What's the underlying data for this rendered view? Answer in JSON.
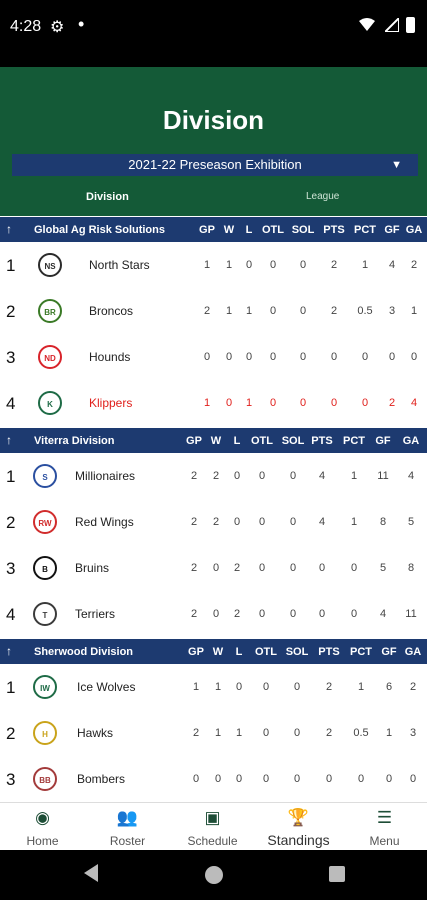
{
  "status": {
    "time": "4:28"
  },
  "header": {
    "title": "Division",
    "season": "2021-22 Preseason Exhibition",
    "tabs": {
      "division": "Division",
      "league": "League"
    }
  },
  "columns": [
    "GP",
    "W",
    "L",
    "OTL",
    "SOL",
    "PTS",
    "PCT",
    "GF",
    "GA"
  ],
  "divisions": [
    {
      "name": "Global Ag Risk Solutions",
      "teams": [
        {
          "rank": "1",
          "name": "North Stars",
          "logo": "NS",
          "logo_color": "#2b2b2b",
          "stats": [
            "1",
            "1",
            "0",
            "0",
            "0",
            "2",
            "1",
            "4",
            "2"
          ]
        },
        {
          "rank": "2",
          "name": "Broncos",
          "logo": "BR",
          "logo_color": "#3a7a26",
          "stats": [
            "2",
            "1",
            "1",
            "0",
            "0",
            "2",
            "0.5",
            "3",
            "1"
          ]
        },
        {
          "rank": "3",
          "name": "Hounds",
          "logo": "ND",
          "logo_color": "#d8232a",
          "stats": [
            "0",
            "0",
            "0",
            "0",
            "0",
            "0",
            "0",
            "0",
            "0"
          ]
        },
        {
          "rank": "4",
          "name": "Klippers",
          "logo": "K",
          "logo_color": "#1e6b46",
          "stats": [
            "1",
            "0",
            "1",
            "0",
            "0",
            "0",
            "0",
            "2",
            "4"
          ],
          "highlight": true
        }
      ]
    },
    {
      "name": "Viterra Division",
      "teams": [
        {
          "rank": "1",
          "name": "Millionaires",
          "logo": "S",
          "logo_color": "#2a4fa0",
          "stats": [
            "2",
            "2",
            "0",
            "0",
            "0",
            "4",
            "1",
            "11",
            "4"
          ]
        },
        {
          "rank": "2",
          "name": "Red Wings",
          "logo": "RW",
          "logo_color": "#d12c2c",
          "stats": [
            "2",
            "2",
            "0",
            "0",
            "0",
            "4",
            "1",
            "8",
            "5"
          ]
        },
        {
          "rank": "3",
          "name": "Bruins",
          "logo": "B",
          "logo_color": "#111111",
          "stats": [
            "2",
            "0",
            "2",
            "0",
            "0",
            "0",
            "0",
            "5",
            "8"
          ]
        },
        {
          "rank": "4",
          "name": "Terriers",
          "logo": "T",
          "logo_color": "#3a3a3a",
          "stats": [
            "2",
            "0",
            "2",
            "0",
            "0",
            "0",
            "0",
            "4",
            "11"
          ]
        }
      ]
    },
    {
      "name": "Sherwood Division",
      "teams": [
        {
          "rank": "1",
          "name": "Ice Wolves",
          "logo": "IW",
          "logo_color": "#1e6b46",
          "stats": [
            "1",
            "1",
            "0",
            "0",
            "0",
            "2",
            "1",
            "6",
            "2"
          ]
        },
        {
          "rank": "2",
          "name": "Hawks",
          "logo": "H",
          "logo_color": "#c9a31a",
          "stats": [
            "2",
            "1",
            "1",
            "0",
            "0",
            "2",
            "0.5",
            "1",
            "3"
          ]
        },
        {
          "rank": "3",
          "name": "Bombers",
          "logo": "BB",
          "logo_color": "#a33b3b",
          "stats": [
            "0",
            "0",
            "0",
            "0",
            "0",
            "0",
            "0",
            "0",
            "0"
          ]
        }
      ]
    }
  ],
  "nav": [
    {
      "label": "Home",
      "icon": "home-icon"
    },
    {
      "label": "Roster",
      "icon": "people-icon"
    },
    {
      "label": "Schedule",
      "icon": "calendar-icon"
    },
    {
      "label": "Standings",
      "icon": "trophy-icon",
      "active": true
    },
    {
      "label": "Menu",
      "icon": "menu-icon"
    }
  ],
  "colors": {
    "header": "#145a37",
    "division_bar": "#1d3a70",
    "highlight": "#e0201c"
  }
}
